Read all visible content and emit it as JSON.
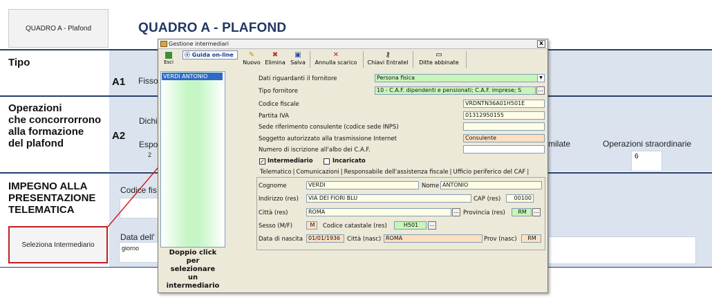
{
  "page": {
    "quadro_button": "QUADRO A - Plafond",
    "title": "QUADRO A - PLAFOND",
    "sections": {
      "tipo": {
        "label": "Tipo",
        "code": "A1",
        "text": "Fisso"
      },
      "operazioni": {
        "label_lines": [
          "Operazioni",
          "che concorrorrono",
          "alla formazione",
          "del plafond"
        ],
        "code": "A2",
        "text1": "Dichi",
        "text2": "Espo",
        "value_left": "2",
        "col_assimilate": "milate",
        "col_straordinarie": "Operazioni straordinarie",
        "value_right": "6"
      },
      "impegno": {
        "label_lines": [
          "IMPEGNO ALLA",
          "PRESENTAZIONE",
          "TELEMATICA"
        ],
        "codice_fis": "Codice fis",
        "data_dell": "Data dell'",
        "giorno": "giorno"
      }
    },
    "select_button": "Seleziona Intermediario"
  },
  "dialog": {
    "title": "Gestione intermediari",
    "close": "x",
    "toolbar": {
      "esci": "Esci",
      "guida": "Guida on-line",
      "nuovo": "Nuovo",
      "elimina": "Elimina",
      "salva": "Salva",
      "annulla": "Annulla scarico",
      "chiavi": "Chiavi Entratel",
      "ditte": "Ditte abbinate"
    },
    "list": [
      "VERDI ANTONIO"
    ],
    "hint": "Doppio click per selezionare un intermediario",
    "form": {
      "dati_fornitore_label": "Dati riguardanti il fornitore",
      "dati_fornitore_value": "Persona fisica",
      "tipo_fornitore_label": "Tipo fornitore",
      "tipo_fornitore_value": "10 - C.A.F. dipendenti e pensionati; C.A.F. imprese; S",
      "codice_fiscale_label": "Codice fiscale",
      "codice_fiscale_value": "VRDNTN36A01H501E",
      "partita_iva_label": "Partita IVA",
      "partita_iva_value": "01312950155",
      "sede_label": "Sede riferimento consulente (codice sede INPS)",
      "sede_value": "",
      "soggetto_label": "Soggetto autorizzato alla trasmissione Internet",
      "soggetto_value": "Consulente",
      "numero_albo_label": "Numero di iscrizione all'albo dei C.A.F.",
      "numero_albo_value": "",
      "intermediario_label": "Intermediario",
      "intermediario_checked": "✓",
      "incaricato_label": "Incaricato"
    },
    "tabs": [
      "Telematico",
      "Comunicazioni",
      "Responsabile dell'assistenza fiscale",
      "Ufficio periferico del CAF"
    ],
    "anagrafica": {
      "cognome_label": "Cognome",
      "cognome": "VERDI",
      "nome_label": "Nome",
      "nome": "ANTONIO",
      "indirizzo_label": "Indirizzo (res)",
      "indirizzo": "VIA DEI FIORI BLU",
      "cap_label": "CAP (res)",
      "cap": "00100",
      "citta_label": "Città (res)",
      "citta": "ROMA",
      "provincia_label": "Provincia (res)",
      "provincia": "RM",
      "sesso_label": "Sesso (M/F)",
      "sesso": "M",
      "catastale_label": "Codice catastale (res)",
      "catastale": "H501",
      "nascita_label": "Data di nascita",
      "nascita": "01/01/1936",
      "citta_nasc_label": "Città (nasc)",
      "citta_nasc": "ROMA",
      "prov_nasc_label": "Prov (nasc)",
      "prov_nasc": "RM"
    }
  },
  "colors": {
    "title": "#1f3864",
    "band": "#dbe3ef",
    "highlight_red": "#c41d1d",
    "green_field": "#c8f5b8",
    "orange_field": "#ffdfc0"
  }
}
